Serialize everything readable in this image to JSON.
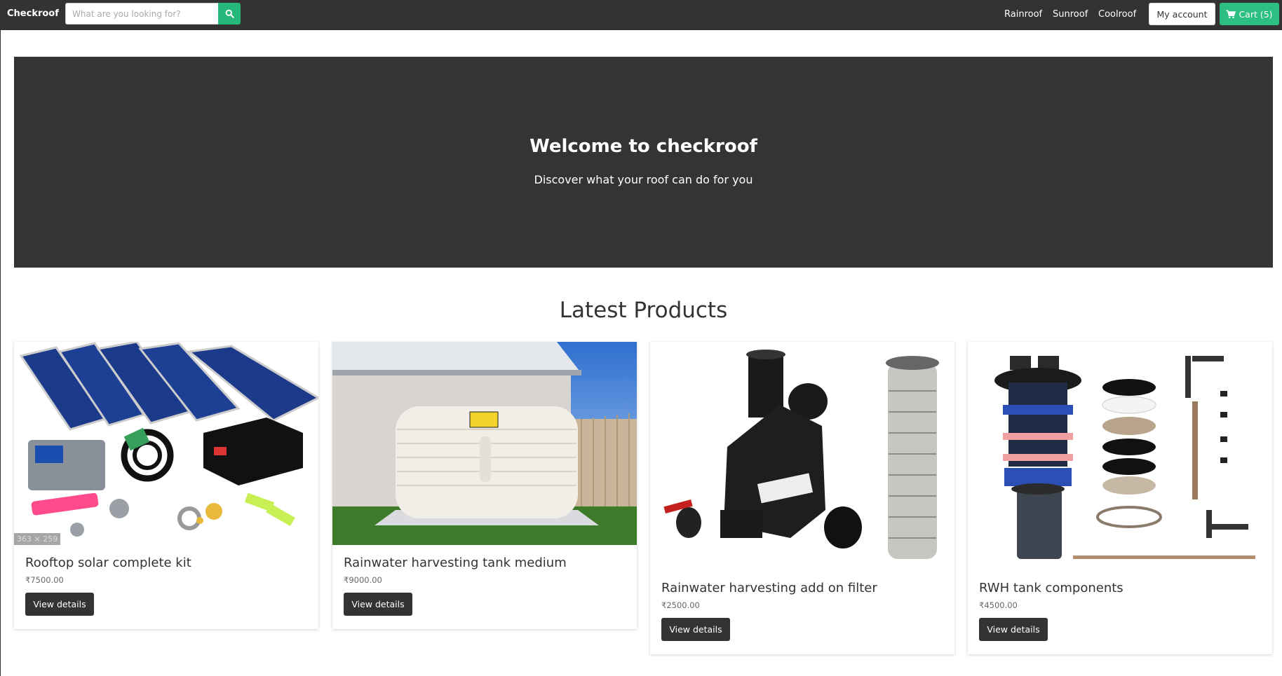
{
  "nav": {
    "brand": "Checkroof",
    "search_placeholder": "What are you looking for?",
    "links": [
      "Rainroof",
      "Sunroof",
      "Coolroof"
    ],
    "account_label": "My account",
    "cart_label": "Cart (5)",
    "accent": "#2cbf82",
    "bg": "#333333"
  },
  "hero": {
    "title": "Welcome to checkroof",
    "subtitle": "Discover what your roof can do for you"
  },
  "products_section": {
    "title": "Latest Products",
    "view_label": "View details",
    "items": [
      {
        "name": "Rooftop solar complete kit",
        "price": "₹7500.00",
        "image": "solar-kit-image",
        "badge": "363 × 259"
      },
      {
        "name": "Rainwater harvesting tank medium",
        "price": "₹9000.00",
        "image": "water-tank-image"
      },
      {
        "name": "Rainwater harvesting add on filter",
        "price": "₹2500.00",
        "image": "rain-filter-image"
      },
      {
        "name": "RWH tank components",
        "price": "₹4500.00",
        "image": "tank-components-image"
      }
    ]
  }
}
